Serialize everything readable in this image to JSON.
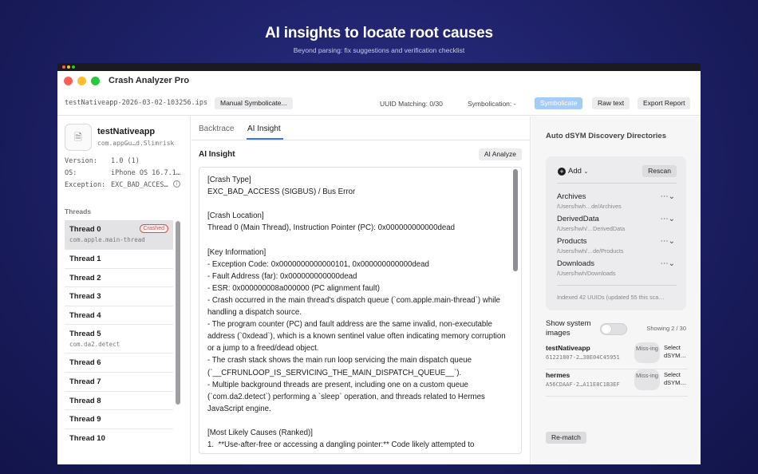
{
  "hero": {
    "title": "AI insights to locate root causes",
    "subtitle": "Beyond parsing: fix suggestions and verification checklist"
  },
  "window": {
    "title": "Crash Analyzer Pro",
    "traffic_lights": [
      "#ff5f57",
      "#febc2e",
      "#28c840"
    ]
  },
  "toolbar": {
    "file_name": "testNativeapp-2026-03-02-103256.ips",
    "manual_symbolicate": "Manual Symbolicate...",
    "uuid_matching": "UUID Matching: 0/30",
    "symbolication": "Symbolication: -",
    "symbolicate": "Symbolicate",
    "raw_text": "Raw text",
    "export_report": "Export Report"
  },
  "sidebar": {
    "app_name": "testNativeapp",
    "app_id": "com.appGu…d.Slimrisk",
    "version_label": "Version:",
    "version_value": "1.0 (1)",
    "os_label": "OS:",
    "os_value": "iPhone OS 16.7.1…",
    "exception_label": "Exception:",
    "exception_value": "EXC_BAD_ACCES…",
    "threads_label": "Threads",
    "crashed_badge": "Crashed",
    "threads": [
      {
        "name": "Thread 0",
        "sub": "com.apple.main-thread"
      },
      {
        "name": "Thread 1",
        "sub": ""
      },
      {
        "name": "Thread 2",
        "sub": ""
      },
      {
        "name": "Thread 3",
        "sub": ""
      },
      {
        "name": "Thread 4",
        "sub": ""
      },
      {
        "name": "Thread 5",
        "sub": "com.da2.detect"
      },
      {
        "name": "Thread 6",
        "sub": ""
      },
      {
        "name": "Thread 7",
        "sub": ""
      },
      {
        "name": "Thread 8",
        "sub": ""
      },
      {
        "name": "Thread 9",
        "sub": ""
      },
      {
        "name": "Thread 10",
        "sub": ""
      }
    ]
  },
  "main": {
    "tabs": [
      {
        "label": "Backtrace"
      },
      {
        "label": "AI Insight"
      }
    ],
    "section_title": "AI Insight",
    "ai_analyze": "AI Analyze",
    "insight_text": "[Crash Type]\nEXC_BAD_ACCESS (SIGBUS) / Bus Error\n\n[Crash Location]\nThread 0 (Main Thread), Instruction Pointer (PC): 0x000000000000dead\n\n[Key Information]\n- Exception Code: 0x0000000000000101, 0x000000000000dead\n- Fault Address (far): 0x000000000000dead\n- ESR: 0x000000008a000000 (PC alignment fault)\n- Crash occurred in the main thread's dispatch queue (`com.apple.main-thread`) while handling a dispatch source.\n- The program counter (PC) and fault address are the same invalid, non-executable address (`0xdead`), which is a known sentinel value often indicating memory corruption or a jump to a freed/dead object.\n- The crash stack shows the main run loop servicing the main dispatch queue (`__CFRUNLOOP_IS_SERVICING_THE_MAIN_DISPATCH_QUEUE__`).\n- Multiple background threads are present, including one on a custom queue (`com.da2.detect`) performing a `sleep` operation, and threads related to Hermes JavaScript engine.\n\n[Most Likely Causes (Ranked)]\n1.  **Use-after-free or accessing a dangling pointer:** Code likely attempted to"
  },
  "right": {
    "title": "Auto dSYM Discovery Directories",
    "add_label": "Add",
    "rescan": "Rescan",
    "directories": [
      {
        "name": "Archives",
        "path": "/Users/hwh…de/Archives"
      },
      {
        "name": "DerivedData",
        "path": "/Users/hwh/…DerivedData"
      },
      {
        "name": "Products",
        "path": "/Users/hwh/…de/Products"
      },
      {
        "name": "Downloads",
        "path": "/Users/hwh/Downloads"
      }
    ],
    "indexed": "Indexed 42 UUIDs (updated 55 this sca…",
    "show_system_images": "Show system images",
    "showing": "Showing 2 / 30",
    "binaries": [
      {
        "name": "testNativeapp",
        "uuid": "61221807-2…38E04C45951",
        "status": "Miss-ing",
        "action": "Select dSYM…"
      },
      {
        "name": "hermes",
        "uuid": "A56CDAAF-2…A11E8C1B3EF",
        "status": "Miss-ing",
        "action": "Select dSYM…"
      }
    ],
    "rematch": "Re-match"
  }
}
